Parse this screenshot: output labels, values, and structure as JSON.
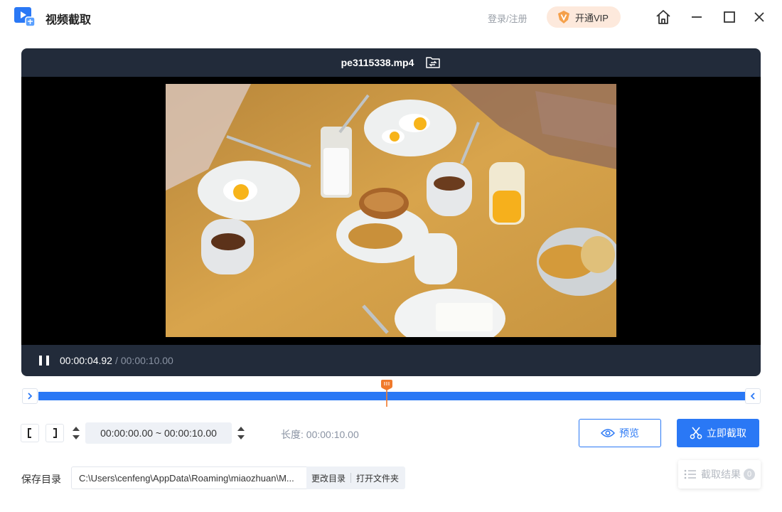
{
  "app": {
    "title": "视频截取"
  },
  "header": {
    "login_label": "登录/注册",
    "vip_label": "开通VIP",
    "vip_badge": "V"
  },
  "player": {
    "filename": "pe3115338.mp4",
    "current_time": "00:00:04.92",
    "separator": "/",
    "total_time": "00:00:10.00",
    "playhead_fraction": 0.492
  },
  "trim": {
    "range_value": "00:00:00.00 ~ 00:00:10.00",
    "length_label": "长度: 00:00:10.00",
    "preview_label": "预览",
    "cut_label": "立即截取"
  },
  "save": {
    "label": "保存目录",
    "path": "C:\\Users\\cenfeng\\AppData\\Roaming\\miaozhuan\\M...",
    "change_dir_label": "更改目录",
    "open_folder_label": "打开文件夹"
  },
  "results": {
    "label": "截取结果",
    "count": "0"
  },
  "colors": {
    "accent": "#2a78f5",
    "playhead": "#f07a2c",
    "player_bg": "#222b3a"
  }
}
